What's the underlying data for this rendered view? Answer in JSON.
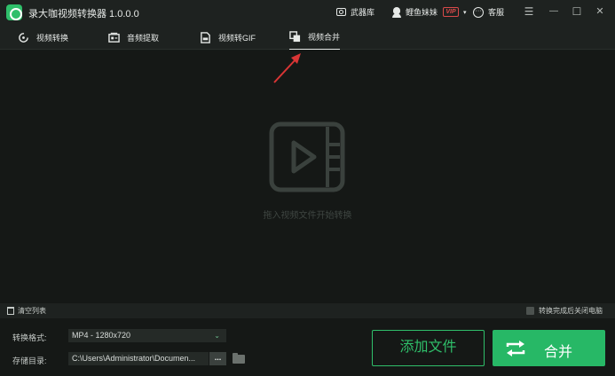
{
  "app": {
    "title": "录大咖视频转换器 1.0.0.0",
    "arsenal_label": "武器库",
    "user_name": "鲤鱼妹妹",
    "vip_badge": "VIP",
    "service_label": "客服",
    "service_glyph": "···",
    "caret": "▾",
    "window_controls": {
      "menu": "☰",
      "minimize": "—",
      "maximize": "☐",
      "close": "✕"
    },
    "accent": "#2fbf6a",
    "vip_color": "#d94a4a"
  },
  "tabs": [
    {
      "label": "视频转换",
      "icon": "rotate-icon",
      "active": false
    },
    {
      "label": "音频提取",
      "icon": "audio-card-icon",
      "active": false
    },
    {
      "label": "视频转GIF",
      "icon": "gif-file-icon",
      "active": false
    },
    {
      "label": "视频合并",
      "icon": "merge-layers-icon",
      "active": true
    }
  ],
  "main": {
    "drop_hint": "拖入视频文件开始转换",
    "drop_icon": "video-play-icon",
    "annotation": "red-arrow-pointer"
  },
  "listbar": {
    "clear_list": "清空列表",
    "shutdown_after": "转换完成后关闭电脑"
  },
  "settings": {
    "format_label": "转换格式:",
    "format_value": "MP4 - 1280x720",
    "format_caret": "⌄",
    "save_dir_label": "存储目录:",
    "save_dir_value": "C:\\Users\\Administrator\\Documen...",
    "browse_label": "..."
  },
  "actions": {
    "add_file": "添加文件",
    "merge": "合并"
  }
}
